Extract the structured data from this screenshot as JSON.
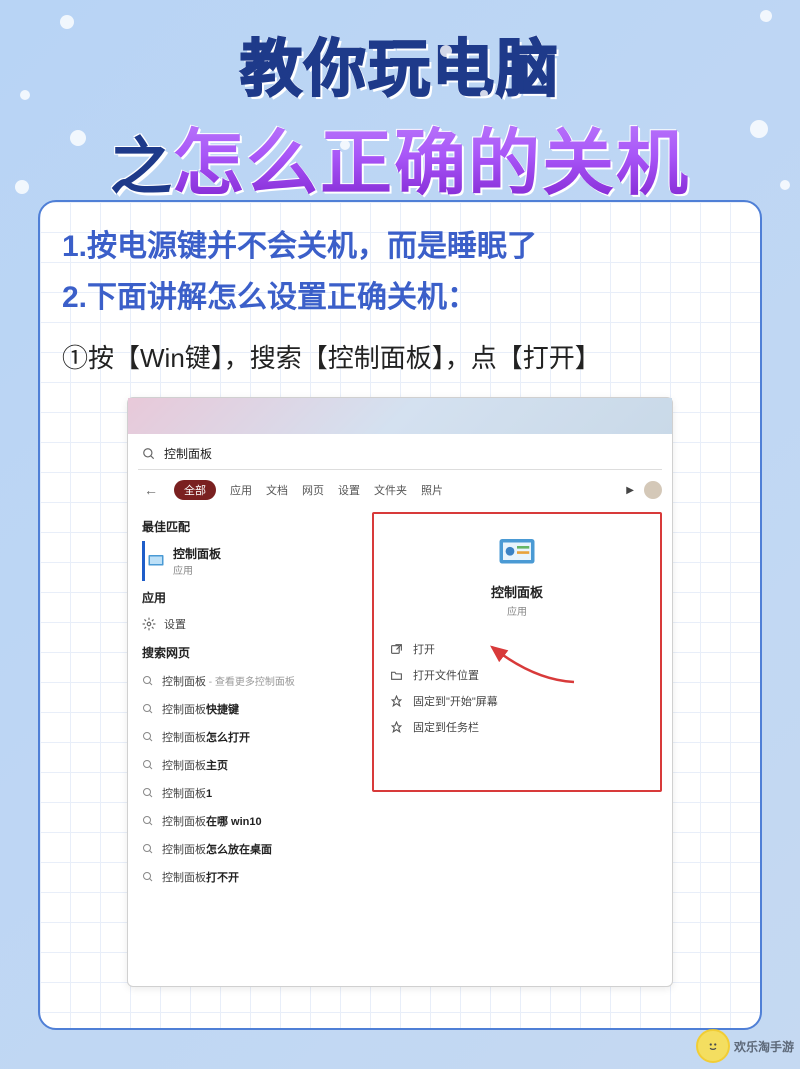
{
  "title": {
    "line1": "教你玩电脑",
    "line2_prefix": "之",
    "line2_main": "怎么正确的关机"
  },
  "instructions": {
    "line1": "1.按电源键并不会关机，而是睡眠了",
    "line2": "2.下面讲解怎么设置正确关机：",
    "step1": "①按【Win键】，搜索【控制面板】，点【打开】"
  },
  "screenshot": {
    "search_value": "控制面板",
    "tabs": {
      "back_icon": "←",
      "active": "全部",
      "items": [
        "应用",
        "文档",
        "网页",
        "设置",
        "文件夹",
        "照片"
      ],
      "play": "▶"
    },
    "left": {
      "best_match_label": "最佳匹配",
      "best_match": {
        "title": "控制面板",
        "subtitle": "应用"
      },
      "apps_label": "应用",
      "settings_label": "设置",
      "search_web_label": "搜索网页",
      "suggestions": [
        {
          "prefix": "控制面板",
          "bold": "",
          "suffix": " - 查看更多控制面板"
        },
        {
          "prefix": "控制面板",
          "bold": "快捷键",
          "suffix": ""
        },
        {
          "prefix": "控制面板",
          "bold": "怎么打开",
          "suffix": ""
        },
        {
          "prefix": "控制面板",
          "bold": "主页",
          "suffix": ""
        },
        {
          "prefix": "控制面板",
          "bold": "1",
          "suffix": ""
        },
        {
          "prefix": "控制面板",
          "bold": "在哪 win10",
          "suffix": ""
        },
        {
          "prefix": "控制面板",
          "bold": "怎么放在桌面",
          "suffix": ""
        },
        {
          "prefix": "控制面板",
          "bold": "打不开",
          "suffix": ""
        }
      ]
    },
    "right": {
      "title": "控制面板",
      "subtitle": "应用",
      "actions": [
        {
          "icon": "open",
          "label": "打开"
        },
        {
          "icon": "folder",
          "label": "打开文件位置"
        },
        {
          "icon": "pin",
          "label": "固定到\"开始\"屏幕"
        },
        {
          "icon": "pin",
          "label": "固定到任务栏"
        }
      ]
    }
  },
  "watermark": "欢乐淘手游"
}
